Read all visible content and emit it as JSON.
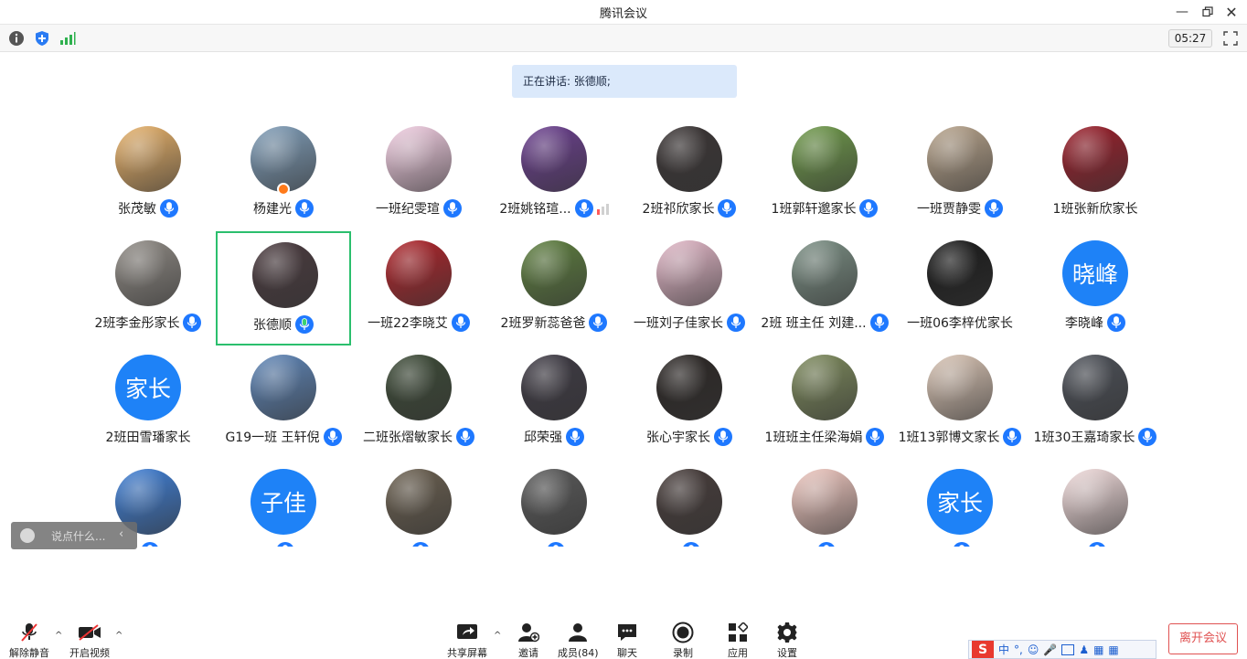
{
  "window": {
    "title": "腾讯会议"
  },
  "toolbar": {
    "timer": "05:27"
  },
  "speaking": {
    "text": "正在讲话: 张德顺;"
  },
  "participants": [
    {
      "name": "张茂敏",
      "avatar": "photo",
      "color": "#e8b26a",
      "mic": "on"
    },
    {
      "name": "杨建光",
      "avatar": "photo",
      "color": "#7f9db8",
      "mic": "on",
      "host": true
    },
    {
      "name": "一班纪雯瑄",
      "avatar": "photo",
      "color": "#f3cfe3",
      "mic": "on"
    },
    {
      "name": "2班姚铭瑄...",
      "avatar": "photo",
      "color": "#6b3f8f",
      "mic": "on",
      "volume": true
    },
    {
      "name": "2班祁欣家长",
      "avatar": "photo",
      "color": "#3a3434",
      "mic": "on"
    },
    {
      "name": "1班郭轩邈家长",
      "avatar": "photo",
      "color": "#6f9a4a",
      "mic": "on"
    },
    {
      "name": "一班贾静雯",
      "avatar": "photo",
      "color": "#b8a48c",
      "mic": "on"
    },
    {
      "name": "1班张新欣家长",
      "avatar": "photo",
      "color": "#9b1e2a",
      "mic": "none"
    },
    {
      "name": "2班李金彤家长",
      "avatar": "photo",
      "color": "#8f8a84",
      "mic": "on"
    },
    {
      "name": "张德顺",
      "avatar": "photo",
      "color": "#4a3a3e",
      "mic": "speaking",
      "active": true
    },
    {
      "name": "一班22李晓艾",
      "avatar": "photo",
      "color": "#b0242a",
      "mic": "on"
    },
    {
      "name": "2班罗新蕊爸爸",
      "avatar": "photo",
      "color": "#5e7f3f",
      "mic": "on"
    },
    {
      "name": "一班刘子佳家长",
      "avatar": "photo",
      "color": "#e3b8c8",
      "mic": "on"
    },
    {
      "name": "2班 班主任 刘建...",
      "avatar": "photo",
      "color": "#7b8f84",
      "mic": "on"
    },
    {
      "name": "一班06李梓优家长",
      "avatar": "photo",
      "color": "#1a1a1a",
      "mic": "none"
    },
    {
      "name": "李晓峰",
      "avatar": "text",
      "text": "晓峰",
      "mic": "on"
    },
    {
      "name": "2班田雪璠家长",
      "avatar": "text",
      "text": "家长",
      "mic": "none"
    },
    {
      "name": "G19一班 王轩倪",
      "avatar": "photo",
      "color": "#5f86b8",
      "mic": "on"
    },
    {
      "name": "二班张熠敏家长",
      "avatar": "photo",
      "color": "#3c4a36",
      "mic": "on"
    },
    {
      "name": "邱荣强",
      "avatar": "photo",
      "color": "#3e3a44",
      "mic": "on"
    },
    {
      "name": "张心宇家长",
      "avatar": "photo",
      "color": "#2b2624",
      "mic": "on"
    },
    {
      "name": "1班班主任梁海娟",
      "avatar": "photo",
      "color": "#7d8a5c",
      "mic": "on"
    },
    {
      "name": "1班13郭博文家长",
      "avatar": "photo",
      "color": "#d9c4b4",
      "mic": "on"
    },
    {
      "name": "1班30王嘉琦家长",
      "avatar": "photo",
      "color": "#4c5058",
      "mic": "on"
    },
    {
      "name": "",
      "avatar": "photo",
      "color": "#3f7fd6",
      "mic": "on"
    },
    {
      "name": "",
      "avatar": "text",
      "text": "子佳",
      "mic": "on"
    },
    {
      "name": "",
      "avatar": "photo",
      "color": "#6b6050",
      "mic": "on"
    },
    {
      "name": "",
      "avatar": "photo",
      "color": "#5a5a5a",
      "mic": "on"
    },
    {
      "name": "",
      "avatar": "photo",
      "color": "#473c3a",
      "mic": "on"
    },
    {
      "name": "",
      "avatar": "photo",
      "color": "#f0c8c0",
      "mic": "on"
    },
    {
      "name": "",
      "avatar": "text",
      "text": "家长",
      "mic": "on"
    },
    {
      "name": "",
      "avatar": "photo",
      "color": "#f2dcdc",
      "mic": "on"
    }
  ],
  "chat": {
    "placeholder": "说点什么..."
  },
  "bottombar": {
    "unmute": "解除静音",
    "video": "开启视频",
    "share": "共享屏幕",
    "invite": "邀请",
    "members": "成员(84)",
    "chat": "聊天",
    "record": "录制",
    "apps": "应用",
    "settings": "设置",
    "leave": "离开会议"
  },
  "ime": {
    "lang": "中"
  }
}
